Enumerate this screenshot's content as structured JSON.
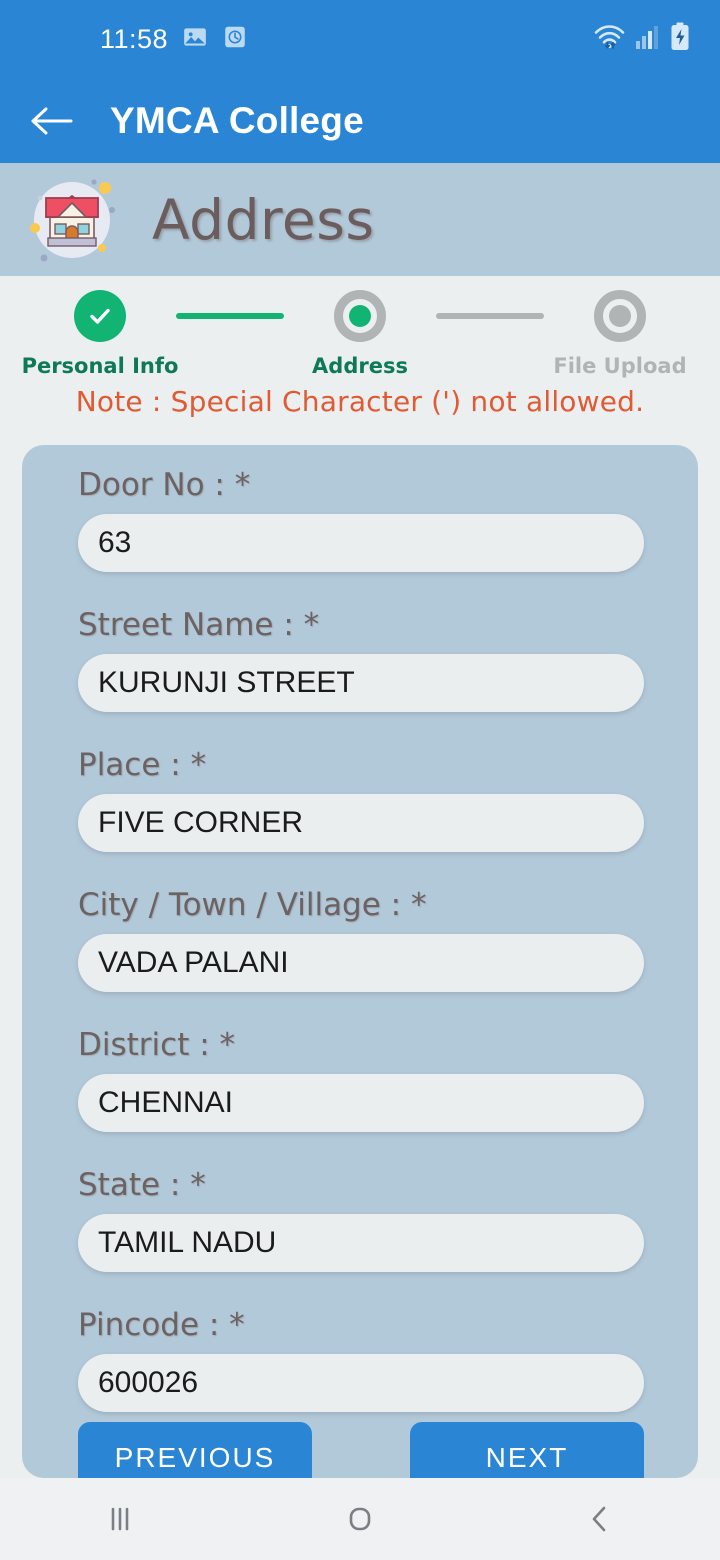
{
  "status_bar": {
    "time": "11:58",
    "icons": [
      "image-icon",
      "alarm-clock-icon",
      "wifi-icon",
      "cellular-signal-icon",
      "battery-charging-icon"
    ]
  },
  "app_bar": {
    "back_icon": "back-arrow-icon",
    "title": "YMCA College"
  },
  "banner": {
    "icon": "house-icon",
    "title": "Address"
  },
  "stepper": {
    "steps": [
      {
        "label": "Personal Info",
        "state": "completed"
      },
      {
        "label": "Address",
        "state": "active"
      },
      {
        "label": "File Upload",
        "state": "idle"
      }
    ]
  },
  "note": "Note : Special Character (') not allowed.",
  "form": {
    "fields": [
      {
        "label": "Door No : *",
        "value": "63"
      },
      {
        "label": "Street Name : *",
        "value": "KURUNJI STREET"
      },
      {
        "label": "Place : *",
        "value": "FIVE CORNER"
      },
      {
        "label": "City / Town / Village : *",
        "value": "VADA PALANI"
      },
      {
        "label": "District : *",
        "value": "CHENNAI"
      },
      {
        "label": "State : *",
        "value": "TAMIL NADU"
      },
      {
        "label": "Pincode : *",
        "value": "600026"
      }
    ],
    "previous_label": "PREVIOUS",
    "next_label": "NEXT"
  },
  "nav_bar": {
    "recents_icon": "recents-icon",
    "home_icon": "home-icon",
    "back_icon": "back-icon"
  },
  "colors": {
    "primary_blue": "#2a86d4",
    "banner_blue_gray": "#b2c9d9",
    "page_bg": "#eceff0",
    "note_red": "#e05a33",
    "step_green": "#12b473",
    "step_gray": "#b1b4b5",
    "input_bg": "#ebeeef",
    "label_gray": "#6d6262"
  }
}
